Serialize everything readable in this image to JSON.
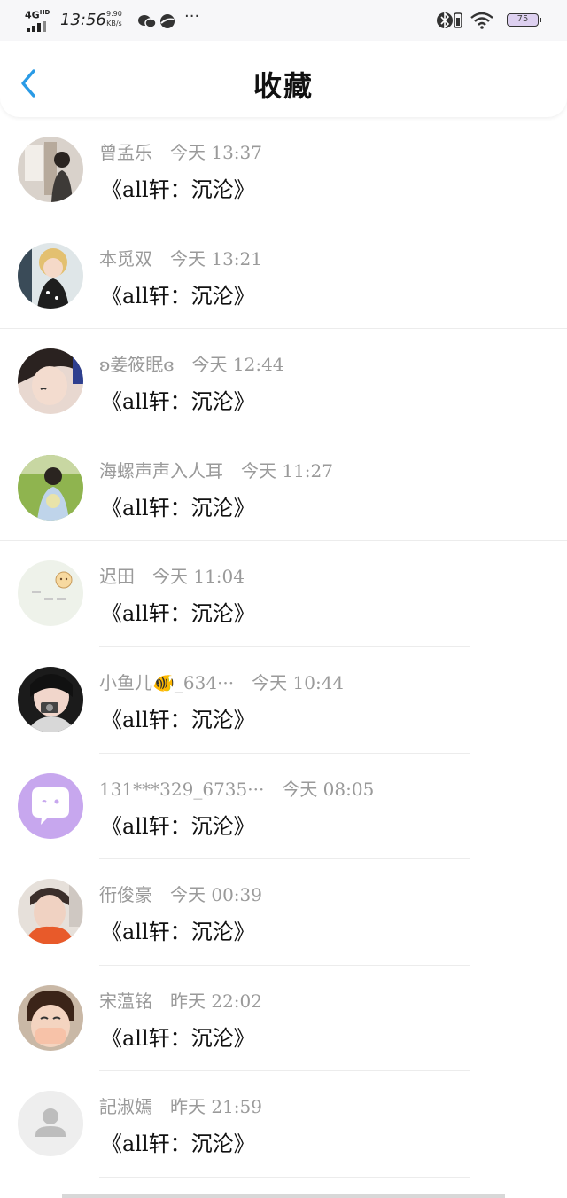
{
  "status_bar": {
    "network": "4G",
    "network_sup": "HD",
    "time": "13:56",
    "speed_value": "9.90",
    "speed_unit": "KB/s",
    "more": "···",
    "battery": "75"
  },
  "header": {
    "title": "收藏"
  },
  "items": [
    {
      "name": "曾孟乐",
      "time": "今天 13:37",
      "message": "《all轩：沉沦》",
      "avatar": "photo-boy"
    },
    {
      "name": "本觅双",
      "time": "今天 13:21",
      "message": "《all轩：沉沦》",
      "avatar": "photo-child"
    },
    {
      "name": "ʚ姜筱眠ɞ",
      "time": "今天 12:44",
      "message": "《all轩：沉沦》",
      "avatar": "photo-girl"
    },
    {
      "name": "海螺声声入人耳",
      "time": "今天 11:27",
      "message": "《all轩：沉沦》",
      "avatar": "photo-outdoor"
    },
    {
      "name": "迟田",
      "time": "今天 11:04",
      "message": "《all轩：沉沦》",
      "avatar": "cartoon-sun"
    },
    {
      "name": "小鱼儿🐠_634···",
      "time": "今天 10:44",
      "message": "《all轩：沉沦》",
      "avatar": "photo-camera"
    },
    {
      "name": "131***329_6735···",
      "time": "今天 08:05",
      "message": "《all轩：沉沦》",
      "avatar": "default-chat"
    },
    {
      "name": "衎俊豪",
      "time": "今天 00:39",
      "message": "《all轩：沉沦》",
      "avatar": "photo-man"
    },
    {
      "name": "宋蕰铭",
      "time": "昨天 22:02",
      "message": "《all轩：沉沦》",
      "avatar": "photo-laugh"
    },
    {
      "name": "記淑嫣",
      "time": "昨天 21:59",
      "message": "《all轩：沉沦》",
      "avatar": "default-user"
    }
  ],
  "colors": {
    "accent": "#2a9be6",
    "meta_text": "#9a9a9a",
    "message_text": "#111111",
    "chat_avatar_bg": "#c7a7ee"
  }
}
